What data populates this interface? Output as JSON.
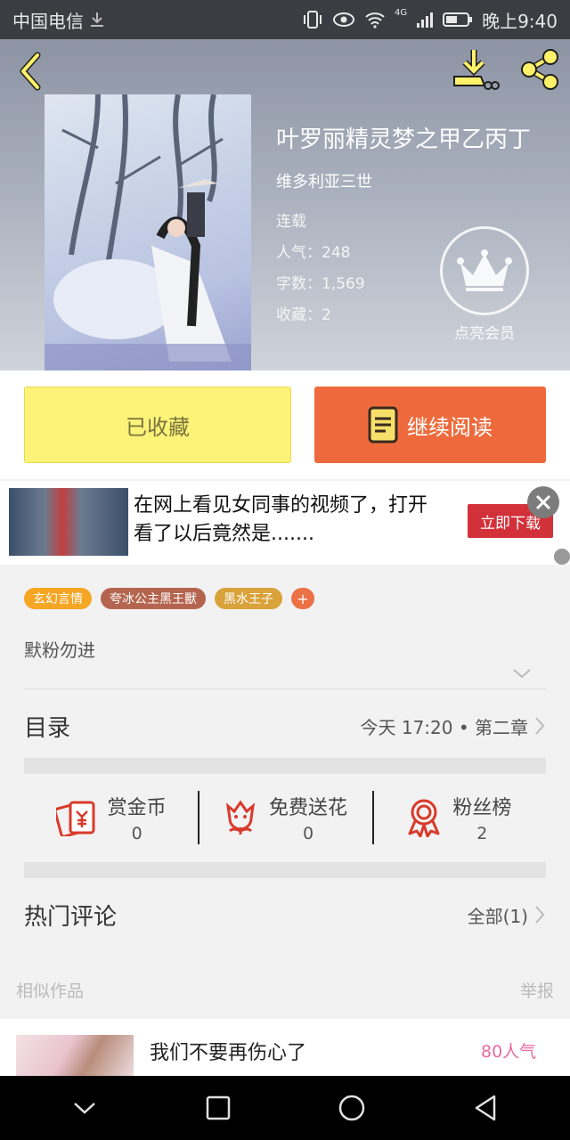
{
  "status_bar": {
    "carrier": "中国电信",
    "network": "4G",
    "time": "晚上9:40"
  },
  "book": {
    "title": "叶罗丽精灵梦之甲乙丙丁",
    "author": "维多利亚三世",
    "status": "连载",
    "popularity": "人气：248",
    "word_count": "字数：1,569",
    "favorites": "收藏：2",
    "member_label": "点亮会员"
  },
  "actions": {
    "collected_label": "已收藏",
    "read_label": "继续阅读"
  },
  "ad": {
    "text": "在网上看见女同事的视频了，打开看了以后竟然是.......",
    "button_label": "立即下载"
  },
  "tags": [
    {
      "label": "玄幻言情",
      "color": "#f5a623"
    },
    {
      "label": "夸冰公主黑王獸",
      "color": "#b5654f"
    },
    {
      "label": "黑水王子",
      "color": "#d9a23a"
    }
  ],
  "tag_more": "+",
  "intro": "默粉勿进",
  "catalog": {
    "title": "目录",
    "latest": "今天 17:20 • 第二章"
  },
  "stats": [
    {
      "name": "赏金币",
      "value": "0",
      "icon": "red-envelope-icon"
    },
    {
      "name": "免费送花",
      "value": "0",
      "icon": "flower-icon"
    },
    {
      "name": "粉丝榜",
      "value": "2",
      "icon": "medal-icon"
    }
  ],
  "comments": {
    "title": "热门评论",
    "all_label": "全部(1)"
  },
  "similar": {
    "title": "相似作品",
    "report": "举报",
    "items": [
      {
        "title": "我们不要再伤心了",
        "popularity": "80人气"
      }
    ]
  },
  "colors": {
    "accent_orange": "#ee6a3c",
    "collected_yellow": "#fdf379",
    "ad_red": "#d2313a",
    "icon_red": "#d93a2b"
  }
}
